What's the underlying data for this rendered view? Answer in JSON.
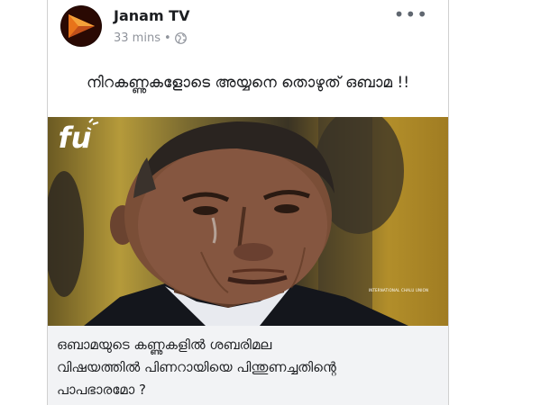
{
  "post": {
    "page_name": "Janam TV",
    "time": "33 mins",
    "separator": "•",
    "privacy_icon": "globe-icon",
    "more_icon": "more-options-icon",
    "more_label": "•••",
    "caption": "നിറകണ്ണുകളോടെ അയ്യനെ തൊഴുത് ഒബാമ !!",
    "image": {
      "description_icon": "photo",
      "watermark_lines": [
        "fu",
        "INTERNATIONAL CHALU UNION"
      ]
    },
    "link_title_lines": [
      "ഒബാമയുടെ കണ്ണുകളിൽ ശബരിമല",
      "വിഷയത്തിൽ പിണറായിയെ പിന്തുണച്ചതിന്റെ",
      "പാപഭാരമോ ?"
    ]
  },
  "colors": {
    "text": "#1c1e21",
    "meta": "#90949c",
    "link_bg": "#f2f3f5",
    "avatar_accent": "#e8731a"
  }
}
